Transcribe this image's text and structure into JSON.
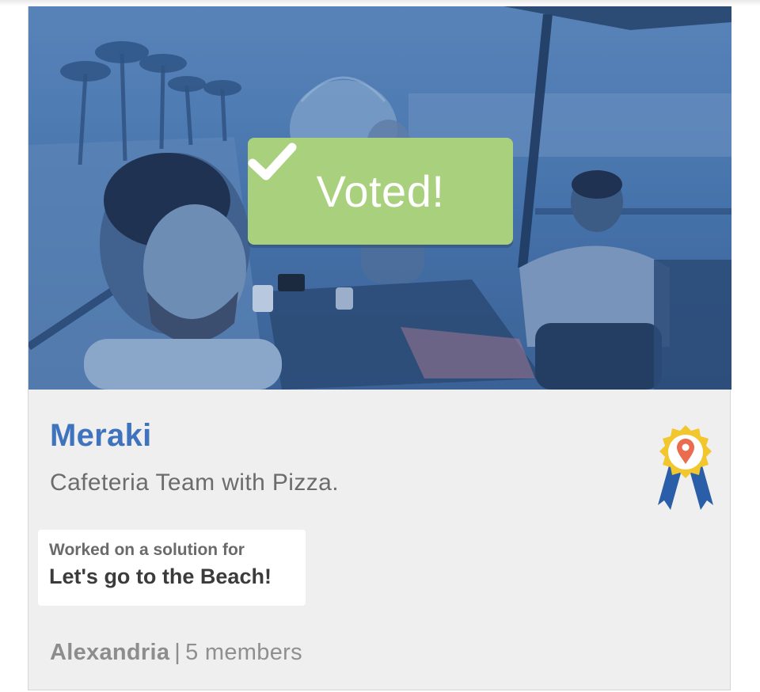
{
  "card": {
    "status_label": "Voted!",
    "team_name": "Meraki",
    "description": "Cafeteria Team with Pizza.",
    "solution": {
      "label": "Worked on a solution for",
      "challenge": "Let's go to the Beach!"
    },
    "footer": {
      "city": "Alexandria",
      "separator": "|",
      "members": "5 members"
    },
    "icons": {
      "status": "checkmark-icon",
      "award": "award-ribbon-location-icon"
    },
    "colors": {
      "accent": "#3f73be",
      "voted": "#a9d17d",
      "photo_overlay": "#4a78b0",
      "ribbon_gold": "#f2c62d",
      "ribbon_blue": "#2a5ea8",
      "pin": "#ea6b4d"
    }
  }
}
